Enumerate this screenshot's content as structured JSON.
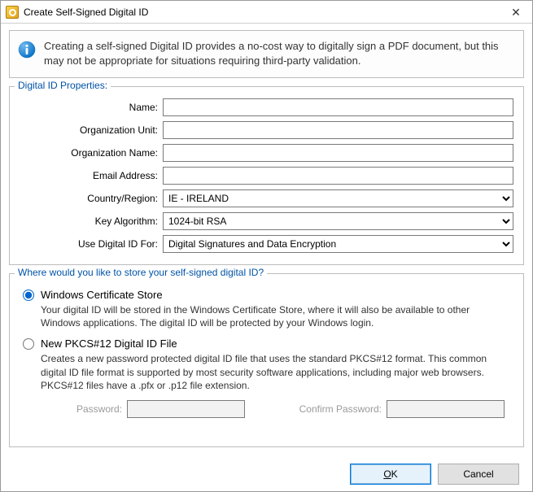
{
  "window": {
    "title": "Create Self-Signed Digital ID",
    "close_glyph": "✕"
  },
  "info": {
    "text": "Creating a self-signed Digital ID provides a no-cost way to digitally sign a PDF document, but this may not be appropriate for situations requiring third-party validation."
  },
  "properties": {
    "legend": "Digital ID Properties:",
    "name_label": "Name:",
    "org_unit_label": "Organization Unit:",
    "org_name_label": "Organization Name:",
    "email_label": "Email Address:",
    "country_label": "Country/Region:",
    "country_value": "IE - IRELAND",
    "key_alg_label": "Key Algorithm:",
    "key_alg_value": "1024-bit RSA",
    "use_for_label": "Use Digital ID For:",
    "use_for_value": "Digital Signatures and Data Encryption",
    "name_value": "",
    "org_unit_value": "",
    "org_name_value": "",
    "email_value": ""
  },
  "storage": {
    "legend": "Where would you like to store your self-signed digital ID?",
    "option1_title": "Windows Certificate Store",
    "option1_desc": "Your digital ID will be stored in the Windows Certificate Store, where it will also be available to other Windows applications. The digital ID will be protected by your Windows login.",
    "option2_title": "New PKCS#12 Digital ID File",
    "option2_desc": "Creates a new password protected digital ID file that uses the standard PKCS#12 format. This common digital ID file format is supported by most security software applications, including major web browsers. PKCS#12 files have a .pfx or .p12 file extension.",
    "password_label": "Password:",
    "confirm_label": "Confirm Password:",
    "password_value": "",
    "confirm_value": ""
  },
  "buttons": {
    "ok_letter": "O",
    "ok_rest": "K",
    "cancel": "Cancel"
  }
}
